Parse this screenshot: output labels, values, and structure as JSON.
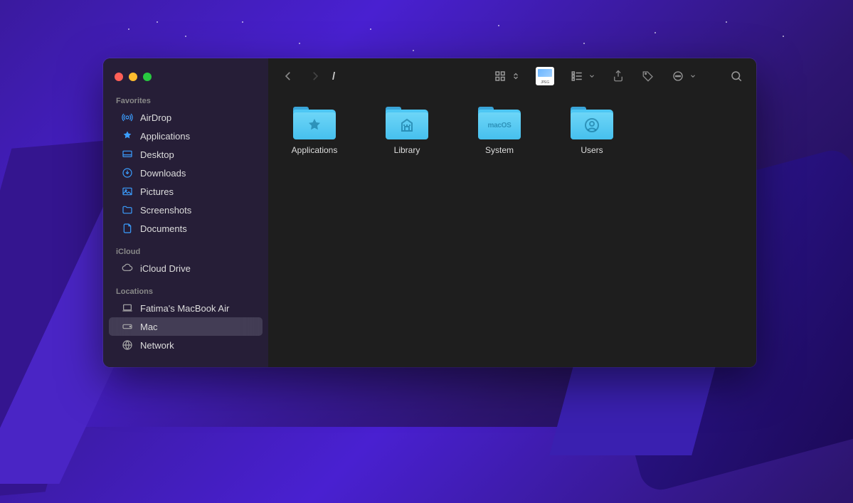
{
  "path_title": "/",
  "sidebar": {
    "sections": [
      {
        "label": "Favorites",
        "items": [
          {
            "name": "AirDrop",
            "icon": "airdrop"
          },
          {
            "name": "Applications",
            "icon": "applications"
          },
          {
            "name": "Desktop",
            "icon": "desktop"
          },
          {
            "name": "Downloads",
            "icon": "downloads"
          },
          {
            "name": "Pictures",
            "icon": "pictures"
          },
          {
            "name": "Screenshots",
            "icon": "folder"
          },
          {
            "name": "Documents",
            "icon": "documents"
          }
        ]
      },
      {
        "label": "iCloud",
        "items": [
          {
            "name": "iCloud Drive",
            "icon": "cloud"
          }
        ]
      },
      {
        "label": "Locations",
        "items": [
          {
            "name": "Fatima's MacBook Air",
            "icon": "laptop"
          },
          {
            "name": "Mac",
            "icon": "disk",
            "selected": true
          },
          {
            "name": "Network",
            "icon": "globe"
          }
        ]
      }
    ]
  },
  "folders": [
    {
      "name": "Applications",
      "glyph": "apps"
    },
    {
      "name": "Library",
      "glyph": "library"
    },
    {
      "name": "System",
      "glyph": "macos"
    },
    {
      "name": "Users",
      "glyph": "user"
    }
  ]
}
